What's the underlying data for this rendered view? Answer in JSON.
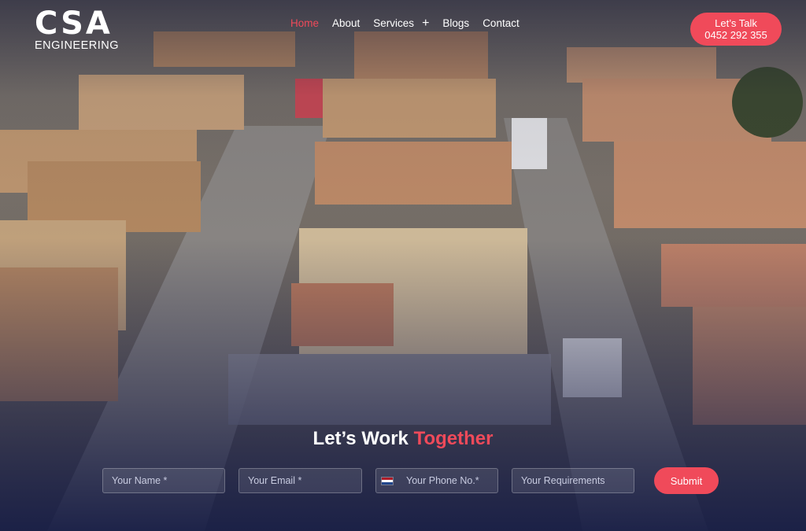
{
  "logo": {
    "mark": "CSA",
    "sub": "ENGINEERING"
  },
  "nav": {
    "home": "Home",
    "about": "About",
    "services": "Services",
    "services_toggle": "+",
    "blogs": "Blogs",
    "contact": "Contact"
  },
  "cta": {
    "line1": "Let’s Talk",
    "line2": "0452 292 355"
  },
  "hero": {
    "headline_main": "Let’s Work ",
    "headline_accent": "Together"
  },
  "form": {
    "name_placeholder": "Your Name *",
    "email_placeholder": "Your Email *",
    "phone_placeholder": "Your Phone No.*",
    "requirements_placeholder": "Your Requirements",
    "submit_label": "Submit"
  },
  "colors": {
    "accent": "#f04a5a",
    "overlay": "#1b2140"
  },
  "icons": {
    "phone_country": "netherlands-flag-icon",
    "services_expand": "plus-icon"
  }
}
